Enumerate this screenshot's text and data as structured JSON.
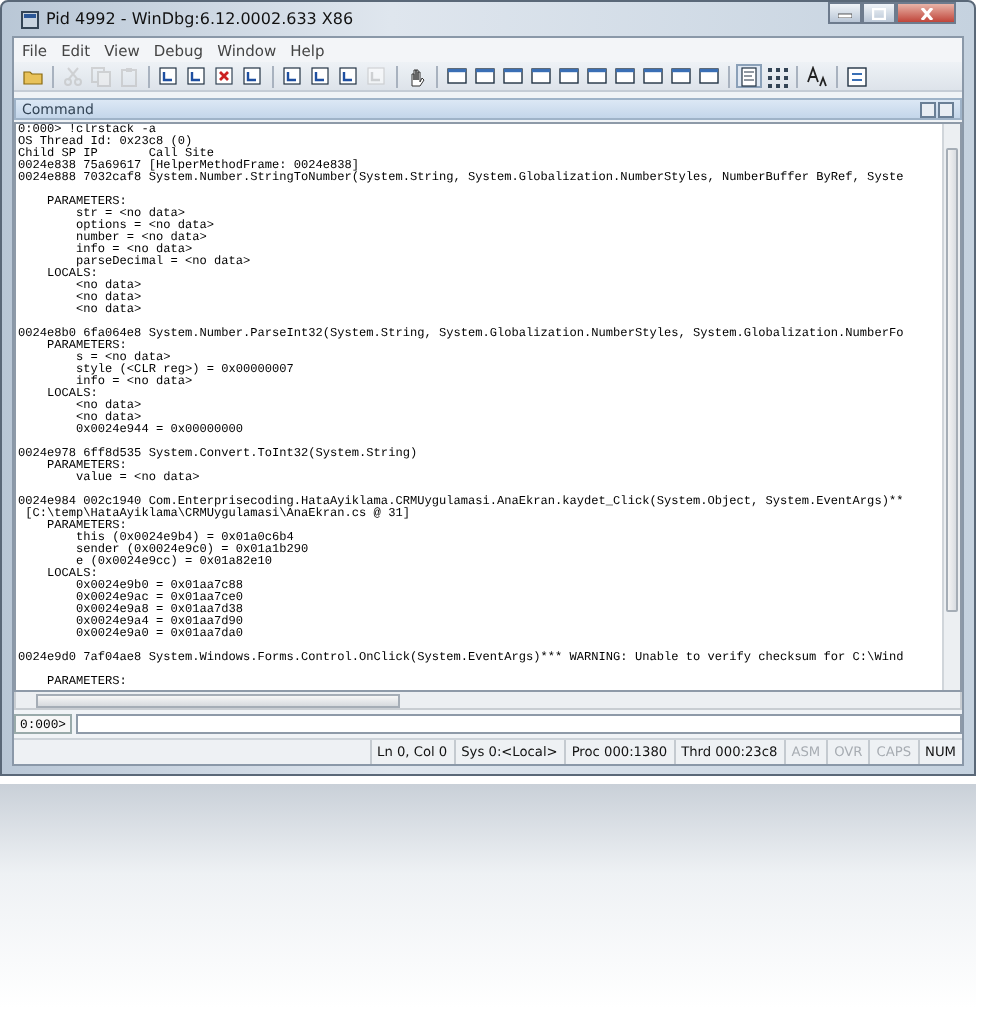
{
  "window": {
    "title": "Pid 4992 - WinDbg:6.12.0002.633 X86"
  },
  "menu": [
    {
      "label": "File"
    },
    {
      "label": "Edit"
    },
    {
      "label": "View"
    },
    {
      "label": "Debug"
    },
    {
      "label": "Window"
    },
    {
      "label": "Help"
    }
  ],
  "toolbar": [
    {
      "kind": "open",
      "disabled": false,
      "pressed": false
    },
    {
      "kind": "sep"
    },
    {
      "kind": "cut",
      "disabled": true,
      "pressed": false
    },
    {
      "kind": "copy",
      "disabled": true,
      "pressed": false
    },
    {
      "kind": "paste",
      "disabled": true,
      "pressed": false
    },
    {
      "kind": "sep"
    },
    {
      "kind": "step",
      "disabled": false,
      "pressed": false
    },
    {
      "kind": "step",
      "disabled": false,
      "pressed": false
    },
    {
      "kind": "stop",
      "disabled": false,
      "pressed": false
    },
    {
      "kind": "step",
      "disabled": false,
      "pressed": false
    },
    {
      "kind": "sep"
    },
    {
      "kind": "step",
      "disabled": false,
      "pressed": false
    },
    {
      "kind": "step",
      "disabled": false,
      "pressed": false
    },
    {
      "kind": "step",
      "disabled": false,
      "pressed": false
    },
    {
      "kind": "step",
      "disabled": true,
      "pressed": false
    },
    {
      "kind": "sep"
    },
    {
      "kind": "hand",
      "disabled": false,
      "pressed": false
    },
    {
      "kind": "sep"
    },
    {
      "kind": "window",
      "disabled": false,
      "pressed": false
    },
    {
      "kind": "window",
      "disabled": false,
      "pressed": false
    },
    {
      "kind": "window",
      "disabled": false,
      "pressed": false
    },
    {
      "kind": "window",
      "disabled": false,
      "pressed": false
    },
    {
      "kind": "window",
      "disabled": false,
      "pressed": false
    },
    {
      "kind": "window",
      "disabled": false,
      "pressed": false
    },
    {
      "kind": "window",
      "disabled": false,
      "pressed": false
    },
    {
      "kind": "window",
      "disabled": false,
      "pressed": false
    },
    {
      "kind": "window",
      "disabled": false,
      "pressed": false
    },
    {
      "kind": "window",
      "disabled": false,
      "pressed": false
    },
    {
      "kind": "sep"
    },
    {
      "kind": "source",
      "disabled": false,
      "pressed": true
    },
    {
      "kind": "grid",
      "disabled": false,
      "pressed": false
    },
    {
      "kind": "sep"
    },
    {
      "kind": "font",
      "disabled": false,
      "pressed": false
    },
    {
      "kind": "sep"
    },
    {
      "kind": "options",
      "disabled": false,
      "pressed": false
    }
  ],
  "command": {
    "title": "Command",
    "output": [
      [
        "0:000> !clrstack -a",
        "OS Thread Id: 0x23c8 (0)",
        "Child SP IP       Call Site",
        "0024e838 75a69617 [HelperMethodFrame: 0024e838]",
        "0024e888 7032caf8 System.Number.StringToNumber(System.String, System.Globalization.NumberStyles, NumberBuffer ByRef, Syste"
      ],
      [
        "    PARAMETERS:",
        "        str = <no data>",
        "        options = <no data>",
        "        number = <no data>",
        "        info = <no data>",
        "        parseDecimal = <no data>",
        "    LOCALS:",
        "        <no data>",
        "        <no data>",
        "        <no data>"
      ],
      [
        "0024e8b0 6fa064e8 System.Number.ParseInt32(System.String, System.Globalization.NumberStyles, System.Globalization.NumberFo",
        "    PARAMETERS:",
        "        s = <no data>",
        "        style (<CLR reg>) = 0x00000007",
        "        info = <no data>",
        "    LOCALS:",
        "        <no data>",
        "        <no data>",
        "        0x0024e944 = 0x00000000"
      ],
      [
        "0024e978 6ff8d535 System.Convert.ToInt32(System.String)",
        "    PARAMETERS:",
        "        value = <no data>"
      ],
      [
        "0024e984 002c1940 Com.Enterprisecoding.HataAyiklama.CRMUygulamasi.AnaEkran.kaydet_Click(System.Object, System.EventArgs)**",
        " [C:\\temp\\HataAyiklama\\CRMUygulamasi\\AnaEkran.cs @ 31]",
        "    PARAMETERS:",
        "        this (0x0024e9b4) = 0x01a0c6b4",
        "        sender (0x0024e9c0) = 0x01a1b290",
        "        e (0x0024e9cc) = 0x01a82e10",
        "    LOCALS:",
        "        0x0024e9b0 = 0x01aa7c88",
        "        0x0024e9ac = 0x01aa7ce0",
        "        0x0024e9a8 = 0x01aa7d38",
        "        0x0024e9a4 = 0x01aa7d90",
        "        0x0024e9a0 = 0x01aa7da0"
      ],
      [
        "0024e9d0 7af04ae8 System.Windows.Forms.Control.OnClick(System.EventArgs)*** WARNING: Unable to verify checksum for C:\\Wind"
      ],
      [
        "    PARAMETERS:"
      ]
    ],
    "prompt": "0:000>"
  },
  "status_bar": [
    {
      "text": "Ln 0, Col 0",
      "on": true
    },
    {
      "text": "Sys 0:<Local>",
      "on": true
    },
    {
      "text": "Proc 000:1380",
      "on": true
    },
    {
      "text": "Thrd 000:23c8",
      "on": true
    },
    {
      "text": "ASM",
      "on": false
    },
    {
      "text": "OVR",
      "on": false
    },
    {
      "text": "CAPS",
      "on": false
    },
    {
      "text": "NUM",
      "on": true
    }
  ]
}
